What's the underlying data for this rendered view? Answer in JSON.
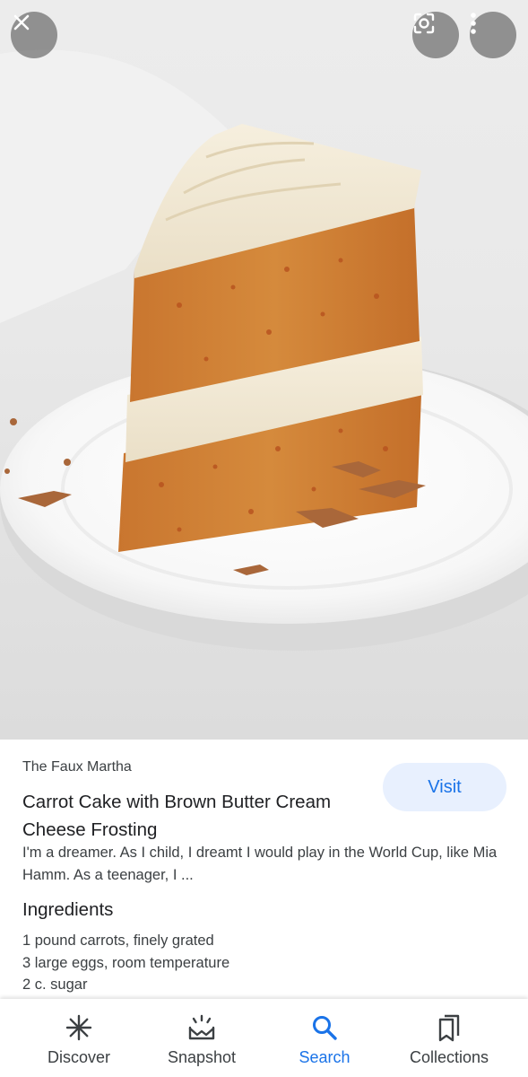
{
  "image": {
    "subject": "carrot-cake-slice-photo"
  },
  "overlay": {
    "close_icon": "close-icon",
    "lens_icon": "lens-icon",
    "more_icon": "more-vert-icon"
  },
  "result": {
    "source": "The Faux Martha",
    "title": "Carrot Cake with Brown Butter Cream Cheese Frosting",
    "visit_label": "Visit",
    "description": "I'm a dreamer. As I child, I dreamt I would play in the World Cup, like Mia Hamm. As a teenager, I ...",
    "ingredients_heading": "Ingredients",
    "ingredients": [
      "1 pound carrots, finely grated",
      "3 large eggs, room temperature",
      "2 c. sugar"
    ]
  },
  "nav": {
    "items": [
      {
        "label": "Discover",
        "icon": "asterisk-icon",
        "active": false
      },
      {
        "label": "Snapshot",
        "icon": "snapshot-icon",
        "active": false
      },
      {
        "label": "Search",
        "icon": "search-icon",
        "active": true
      },
      {
        "label": "Collections",
        "icon": "collections-icon",
        "active": false
      }
    ]
  },
  "colors": {
    "accent": "#1a73e8",
    "visit_bg": "#e8f0fe",
    "text_primary": "#202124",
    "text_secondary": "#3c4043"
  }
}
